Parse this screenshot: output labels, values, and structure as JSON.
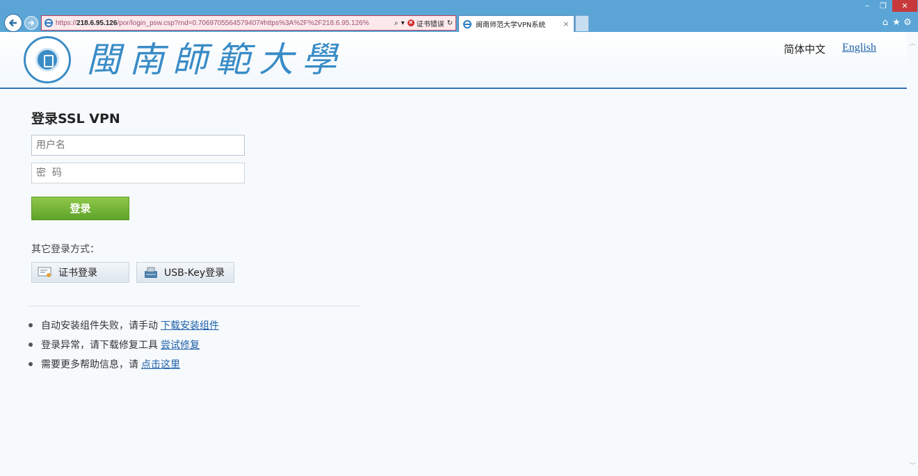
{
  "browser": {
    "url_prefix": "https://",
    "url_host": "218.6.95.126",
    "url_path": "/por/login_psw.csp?rnd=0.7069705564579407#https%3A%2F%2F218.6.95.126%",
    "cert_error_label": "证书错误",
    "tab_title": "闽南师范大学VPN系统",
    "tab_close": "×",
    "win_min": "–",
    "win_max": "❐",
    "win_close": "✕",
    "home_icon": "⌂",
    "star_icon": "★",
    "gear_icon": "⚙"
  },
  "header": {
    "logo_text": "閩南師範大學",
    "lang_zh": "简体中文",
    "lang_en": "English"
  },
  "login": {
    "title": "登录SSL VPN",
    "username_placeholder": "用户名",
    "password_placeholder": "密  码",
    "submit_label": "登录",
    "other_methods_label": "其它登录方式：",
    "cert_login_label": "证书登录",
    "usbkey_login_label": "USB-Key登录"
  },
  "help": [
    {
      "text": "自动安装组件失败，请手动",
      "link": "下载安装组件"
    },
    {
      "text": "登录异常，请下载修复工具",
      "link": "尝试修复"
    },
    {
      "text": "需要更多帮助信息，请",
      "link": "点击这里"
    }
  ],
  "colors": {
    "chrome": "#5aa5d6",
    "accent_blue": "#2f6fb0",
    "login_green": "#6aad33",
    "link": "#1c5fa8"
  }
}
